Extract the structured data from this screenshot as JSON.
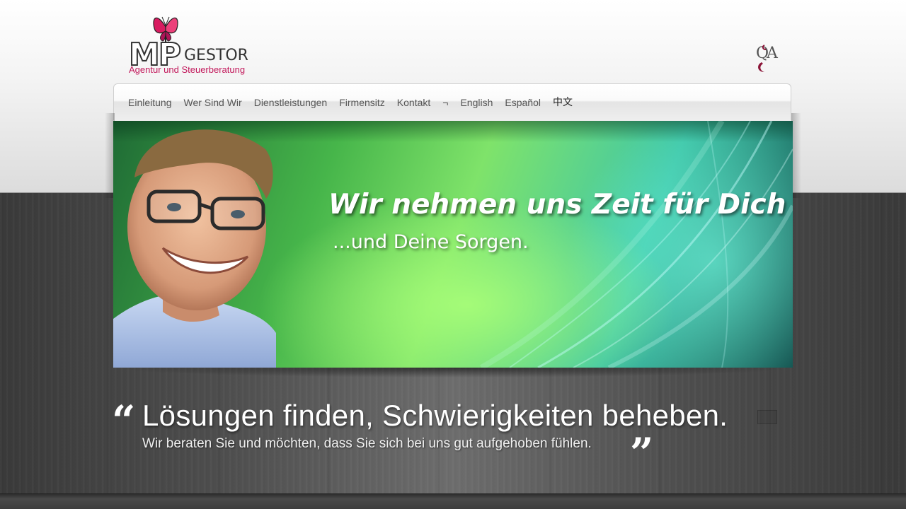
{
  "brand": {
    "logo_mp": "MP",
    "logo_name": "GESTOR",
    "tagline": "Agentur und Steuerberatung",
    "partner_logo_text": "QA"
  },
  "nav": {
    "items": [
      {
        "label": "Einleitung"
      },
      {
        "label": "Wer Sind Wir"
      },
      {
        "label": "Dienstleistungen"
      },
      {
        "label": "Firmensitz"
      },
      {
        "label": "Kontakt"
      },
      {
        "label": "¬"
      },
      {
        "label": "English"
      },
      {
        "label": "Español"
      },
      {
        "label": "中文"
      }
    ]
  },
  "banner": {
    "headline": "Wir nehmen uns Zeit für Dich",
    "subline": "...und Deine Sorgen."
  },
  "quote": {
    "open_mark": "“",
    "title": "Lösungen finden, Schwierigkeiten beheben.",
    "subtitle": "Wir beraten Sie und möchten, dass Sie sich bei uns gut aufgehoben fühlen.",
    "close_mark": "”"
  },
  "colors": {
    "brand_pink": "#c2185b",
    "logo_dark": "#333333",
    "nav_text": "#555555",
    "banner_green": "#7fe36a",
    "background_dark": "#4f4f4f"
  },
  "icons": {
    "logo_symbol": "butterfly-icon",
    "partner_symbol": "qa-logo-icon"
  }
}
